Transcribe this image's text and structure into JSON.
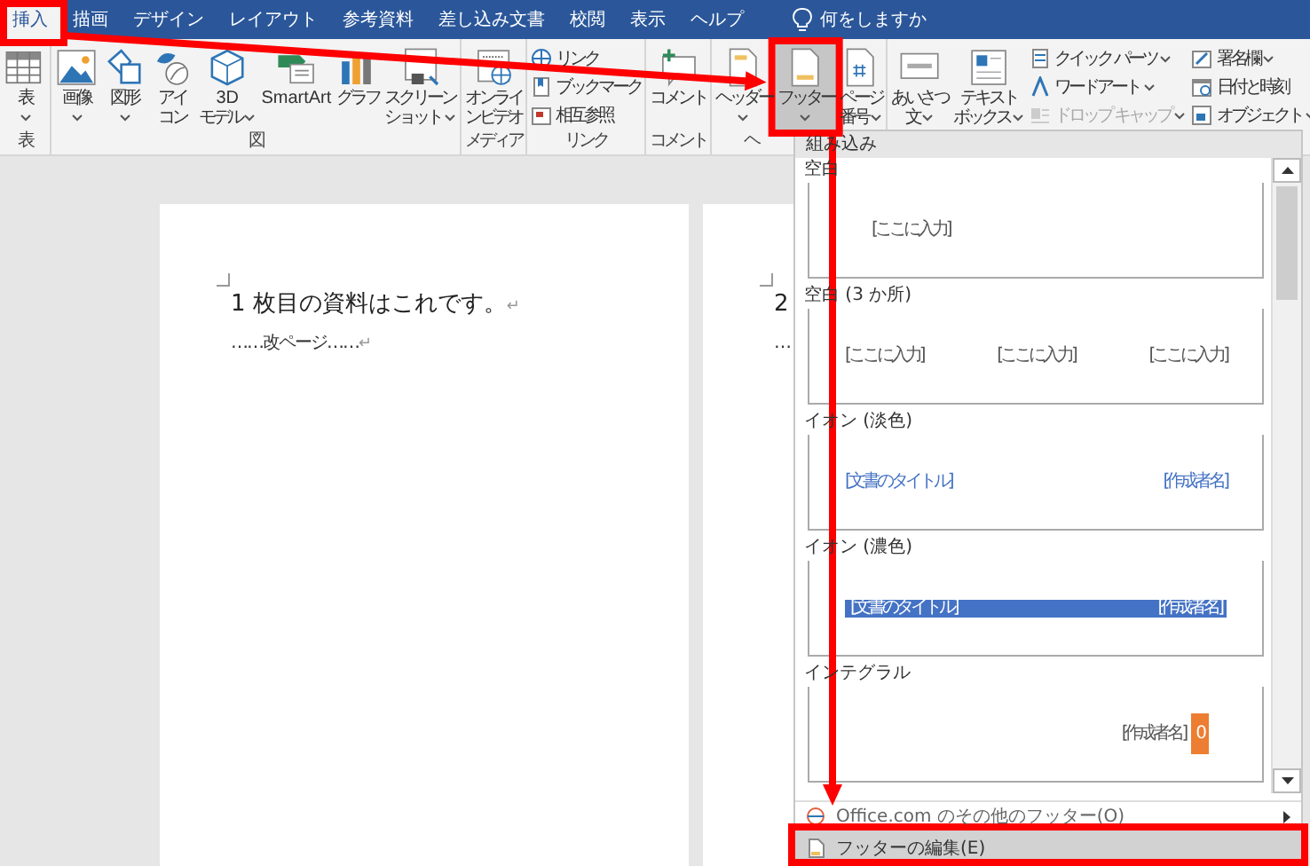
{
  "tabs": [
    {
      "label": "挿入",
      "selected": true,
      "annotated": true
    },
    {
      "label": "描画",
      "selected": false
    },
    {
      "label": "デザイン",
      "selected": false
    },
    {
      "label": "レイアウト",
      "selected": false
    },
    {
      "label": "参考資料",
      "selected": false
    },
    {
      "label": "差し込み文書",
      "selected": false
    },
    {
      "label": "校閲",
      "selected": false
    },
    {
      "label": "表示",
      "selected": false
    },
    {
      "label": "ヘルプ",
      "selected": false
    }
  ],
  "tell_me": "何をしますか",
  "ribbon": [
    {
      "label": "表",
      "buttons": [
        {
          "kind": "large",
          "lines": [
            "表"
          ],
          "dropdown": true,
          "pressed": false,
          "disabled": false
        }
      ]
    },
    {
      "label": "図",
      "buttons": [
        {
          "kind": "large",
          "lines": [
            "画像"
          ],
          "dropdown": true,
          "pressed": false,
          "disabled": false
        },
        {
          "kind": "large",
          "lines": [
            "図形"
          ],
          "dropdown": true,
          "pressed": false,
          "disabled": false
        },
        {
          "kind": "large",
          "lines": [
            "アイ",
            "コン"
          ],
          "dropdown": false,
          "pressed": false,
          "disabled": false
        },
        {
          "kind": "large",
          "lines": [
            "3D",
            "モデル"
          ],
          "dropdown": true,
          "pressed": false,
          "disabled": false
        },
        {
          "kind": "large",
          "lines": [
            "SmartArt"
          ],
          "dropdown": false,
          "pressed": false,
          "disabled": false
        },
        {
          "kind": "large",
          "lines": [
            "グラフ"
          ],
          "dropdown": false,
          "pressed": false,
          "disabled": false
        },
        {
          "kind": "large",
          "lines": [
            "スクリーン",
            "ショット"
          ],
          "dropdown": true,
          "pressed": false,
          "disabled": false
        }
      ]
    },
    {
      "label": "メディア",
      "buttons": [
        {
          "kind": "large",
          "lines": [
            "オンライ",
            "ンビデオ"
          ],
          "dropdown": false,
          "pressed": false,
          "disabled": false
        }
      ]
    },
    {
      "label": "リンク",
      "buttons": [
        {
          "kind": "small",
          "label": "リンク",
          "dropdown": false,
          "pressed": false,
          "disabled": false
        },
        {
          "kind": "small",
          "label": "ブックマーク",
          "dropdown": false,
          "pressed": false,
          "disabled": false
        },
        {
          "kind": "small",
          "label": "相互参照",
          "dropdown": false,
          "pressed": false,
          "disabled": false
        }
      ]
    },
    {
      "label": "コメント",
      "buttons": [
        {
          "kind": "large",
          "lines": [
            "コメント"
          ],
          "dropdown": false,
          "pressed": false,
          "disabled": false
        }
      ]
    },
    {
      "label": "ヘ",
      "buttons": [
        {
          "kind": "large",
          "lines": [
            "ヘッダー"
          ],
          "dropdown": true,
          "pressed": false,
          "disabled": false
        },
        {
          "kind": "large",
          "lines": [
            "フッター"
          ],
          "dropdown": true,
          "pressed": true,
          "disabled": false,
          "annotated": true
        },
        {
          "kind": "large",
          "lines": [
            "ページ",
            "番号"
          ],
          "dropdown": true,
          "pressed": false,
          "disabled": false
        }
      ]
    },
    {
      "buttons": [
        {
          "kind": "large",
          "lines": [
            "あいさつ",
            "文"
          ],
          "dropdown": true,
          "pressed": false,
          "disabled": false
        },
        {
          "kind": "large",
          "lines": [
            "テキスト",
            "ボックス"
          ],
          "dropdown": true,
          "pressed": false,
          "disabled": false
        },
        {
          "kind": "small",
          "label": "クイック パーツ",
          "dropdown": true,
          "pressed": false,
          "disabled": false
        },
        {
          "kind": "small",
          "label": "ワードアート",
          "dropdown": true,
          "pressed": false,
          "disabled": false
        },
        {
          "kind": "small",
          "label": "ドロップ キャップ",
          "dropdown": true,
          "pressed": false,
          "disabled": true
        },
        {
          "kind": "small",
          "label": "署名欄",
          "dropdown": true,
          "pressed": false,
          "disabled": false
        },
        {
          "kind": "small",
          "label": "日付と時刻",
          "dropdown": false,
          "pressed": false,
          "disabled": false
        },
        {
          "kind": "small",
          "label": "オブジェクト",
          "dropdown": true,
          "pressed": false,
          "disabled": false
        }
      ]
    }
  ],
  "pages": [
    {
      "paragraphs": [
        {
          "kind": "text",
          "text": "1 枚目の資料はこれです。",
          "mark": "↵"
        },
        {
          "kind": "page_break",
          "text": "……改ページ……",
          "mark": "↵"
        }
      ]
    },
    {
      "paragraphs": [
        {
          "kind": "text",
          "text": "2"
        },
        {
          "kind": "page_break",
          "text": "…"
        }
      ]
    }
  ],
  "footer_menu": {
    "header": "組み込み",
    "gallery": [
      {
        "title": "空白",
        "kind": "blank",
        "texts": [
          "[ここに入力]"
        ]
      },
      {
        "title": "空白 (3 か所)",
        "kind": "blank3",
        "texts": [
          "[ここに入力]",
          "[ここに入力]",
          "[ここに入力]"
        ]
      },
      {
        "title": "イオン (淡色)",
        "kind": "ion_light",
        "texts": [
          "[文書のタイトル]",
          "[作成者名]"
        ]
      },
      {
        "title": "イオン (濃色)",
        "kind": "ion_dark",
        "texts": [
          "[文書のタイトル]",
          "[作成者名]"
        ]
      },
      {
        "title": "インテグラル",
        "kind": "integral",
        "texts": [
          "[作成者名]",
          "0"
        ]
      }
    ],
    "items": [
      {
        "label": "Office.com のその他のフッター(O)",
        "submenu": true,
        "selected": false
      },
      {
        "label": "フッターの編集(E)",
        "submenu": false,
        "selected": true,
        "annotated": true
      }
    ]
  },
  "annotation_arrows": true
}
